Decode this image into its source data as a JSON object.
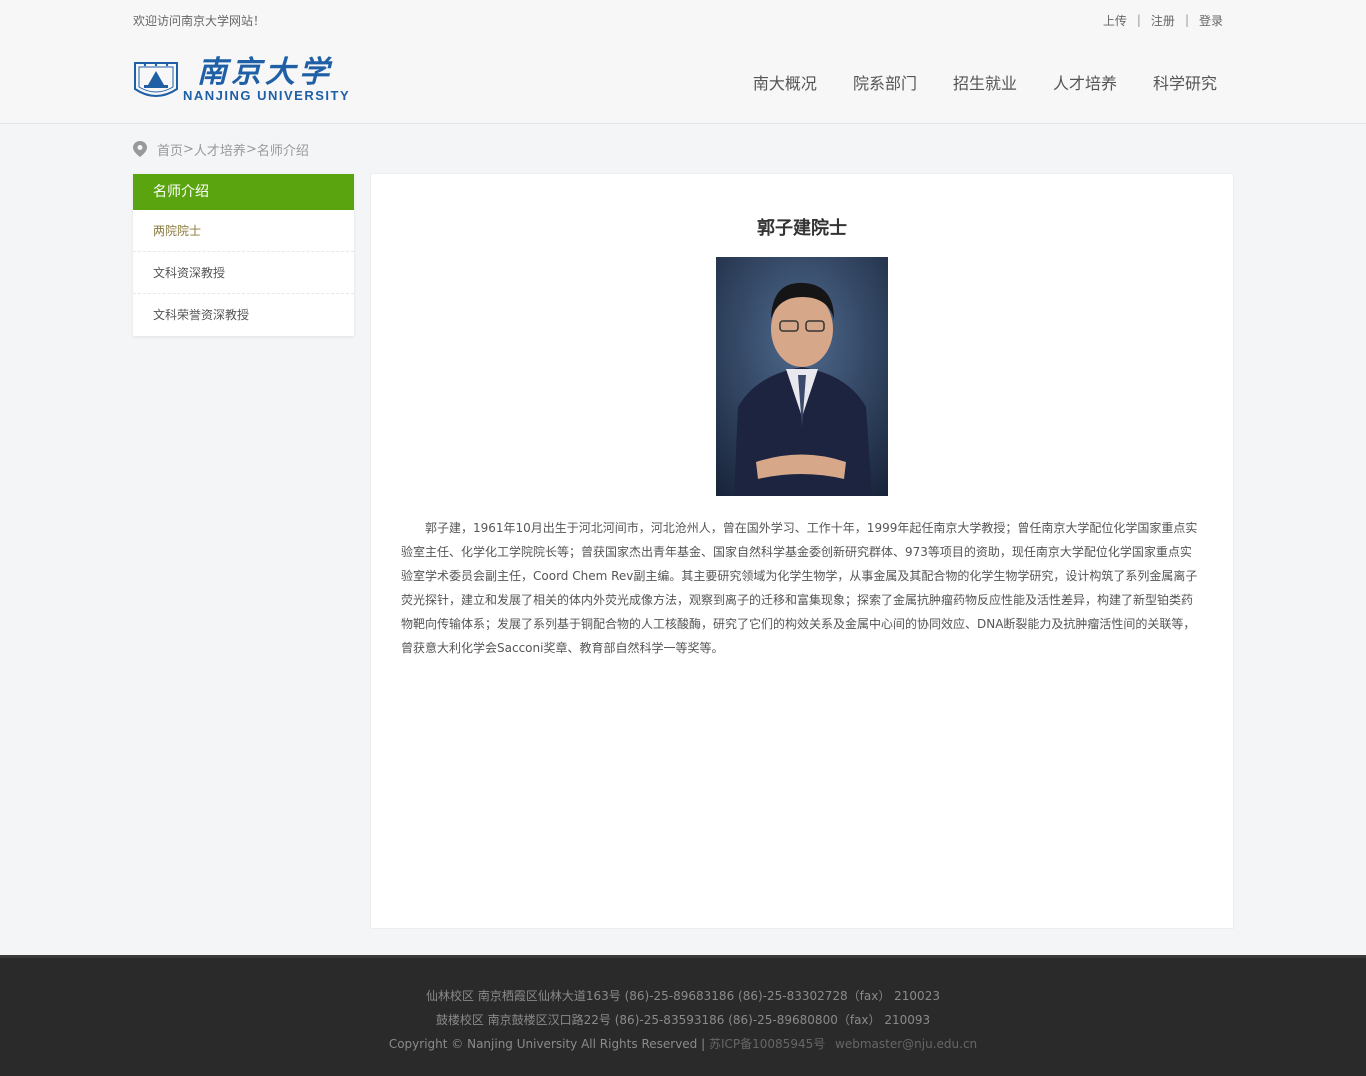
{
  "topbar": {
    "welcome": "欢迎访问南京大学网站！",
    "links": [
      "上传",
      "注册",
      "登录"
    ]
  },
  "logo": {
    "cn": "南京大学",
    "en": "NANJING UNIVERSITY"
  },
  "nav": [
    "南大概况",
    "院系部门",
    "招生就业",
    "人才培养",
    "科学研究"
  ],
  "breadcrumb": {
    "home": "首页",
    "sep1": " > ",
    "section": "人才培养",
    "sep2": "> ",
    "current": "名师介绍"
  },
  "sidebar": {
    "title": "名师介绍",
    "items": [
      "两院院士",
      "文科资深教授",
      "文科荣誉资深教授"
    ]
  },
  "article": {
    "title": "郭子建院士",
    "bio": "郭子建，1961年10月出生于河北河间市，河北沧州人，曾在国外学习、工作十年，1999年起任南京大学教授；曾任南京大学配位化学国家重点实验室主任、化学化工学院院长等；曾获国家杰出青年基金、国家自然科学基金委创新研究群体、973等项目的资助，现任南京大学配位化学国家重点实验室学术委员会副主任，Coord Chem Rev副主编。其主要研究领域为化学生物学，从事金属及其配合物的化学生物学研究，设计构筑了系列金属离子荧光探针，建立和发展了相关的体内外荧光成像方法，观察到离子的迁移和富集现象；探索了金属抗肿瘤药物反应性能及活性差异，构建了新型铂类药物靶向传输体系；发展了系列基于铜配合物的人工核酸酶，研究了它们的构效关系及金属中心间的协同效应、DNA断裂能力及抗肿瘤活性间的关联等，曾获意大利化学会Sacconi奖章、教育部自然科学一等奖等。"
  },
  "footer": {
    "line1": "仙林校区 南京栖霞区仙林大道163号 (86)-25-89683186 (86)-25-83302728（fax） 210023",
    "line2": "鼓楼校区 南京鼓楼区汉口路22号 (86)-25-83593186 (86)-25-89680800（fax） 210093",
    "copyright": "Copyright © Nanjing University All Rights Reserved |",
    "icp": "苏ICP备10085945号",
    "email": "webmaster@nju.edu.cn"
  },
  "colors": {
    "accent_green": "#5aa50f",
    "logo_blue": "#1f5fa6",
    "footer_bg": "#2a2a2a"
  }
}
